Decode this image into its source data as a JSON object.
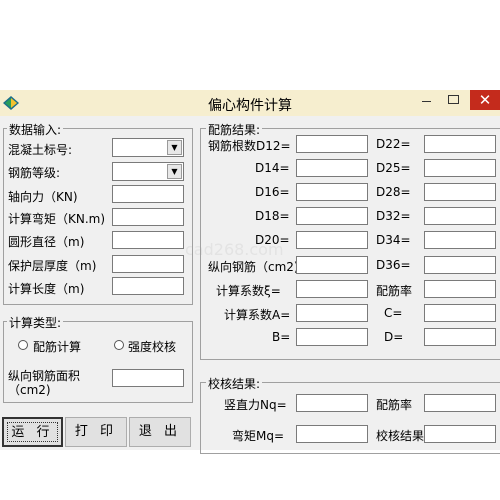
{
  "window": {
    "title": "偏心构件计算",
    "close_glyph": "✕"
  },
  "watermark": "cad268.com",
  "input_group": {
    "legend": "数据输入:",
    "concrete_grade_label": "混凝土标号:",
    "rebar_grade_label": "钢筋等级:",
    "axial_force_label": "轴向力（KN)",
    "design_moment_label": "计算弯矩（KN.m)",
    "diameter_label": "圆形直径（m)",
    "cover_label": "保护层厚度（m)",
    "length_label": "计算长度（m)"
  },
  "calc_type_group": {
    "legend": "计算类型:",
    "option_reinforcement": "配筋计算",
    "option_strength": "强度校核",
    "rebar_area_label": "纵向钢筋面积（cm2)"
  },
  "buttons": {
    "run": "运 行",
    "print": "打 印",
    "exit": "退 出"
  },
  "result_group": {
    "legend": "配筋结果:",
    "rebar_count_label": "钢筋根数D12=",
    "d14": "D14=",
    "d16": "D16=",
    "d18": "D18=",
    "d20": "D20=",
    "d22": "D22=",
    "d25": "D25=",
    "d28": "D28=",
    "d32": "D32=",
    "d34": "D34=",
    "d36": "D36=",
    "long_rebar_label": "纵向钢筋（cm2)",
    "coef_xi_label": "计算系数ξ=",
    "ratio_label": "配筋率",
    "coef_a_label": "计算系数A=",
    "c_label": "C=",
    "b_label": "B=",
    "d_label": "D="
  },
  "check_group": {
    "legend": "校核结果:",
    "vertical_force_label": "竖直力Nq=",
    "ratio_label": "配筋率",
    "moment_label": "弯矩Mq=",
    "check_result_label": "校核结果"
  }
}
